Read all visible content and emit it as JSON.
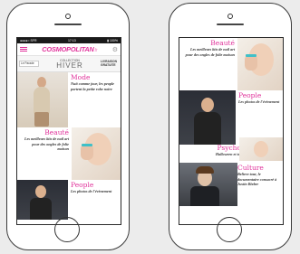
{
  "left_phone": {
    "status_bar": {
      "carrier": "●●●●○ SFR",
      "time": "17:13",
      "battery": "▮ 100%"
    },
    "header": {
      "logo": "COSMOPOLITAN",
      "logo_suffix": ".fr"
    },
    "banner": {
      "left_tag": "Le Parade",
      "collection_label": "COLLECTION",
      "collection_title": "HIVER",
      "promo": "LIVRAISON GRATUITE"
    },
    "cards": [
      {
        "category": "Mode",
        "desc": "Nuit comme jour, les people portent la petite robe noire"
      },
      {
        "category": "Beauté",
        "desc": "Les meilleurs kits de nail art pour des ongles de folie maison"
      },
      {
        "category": "People",
        "desc": "Les photos de l'évènement"
      }
    ]
  },
  "right_phone": {
    "cards": [
      {
        "category": "Beauté",
        "desc": "Les meilleurs kits de nail art pour des ongles de folie maison"
      },
      {
        "category": "People",
        "desc": "Les photos de l'évènement"
      },
      {
        "category": "Psycho",
        "desc": "Halloween et toi"
      },
      {
        "category": "Culture",
        "desc": "Believe tour, le documentaire consacré à Justin Bieber"
      }
    ]
  },
  "colors": {
    "accent": "#e0319a",
    "frame": "#3a3a3a"
  }
}
